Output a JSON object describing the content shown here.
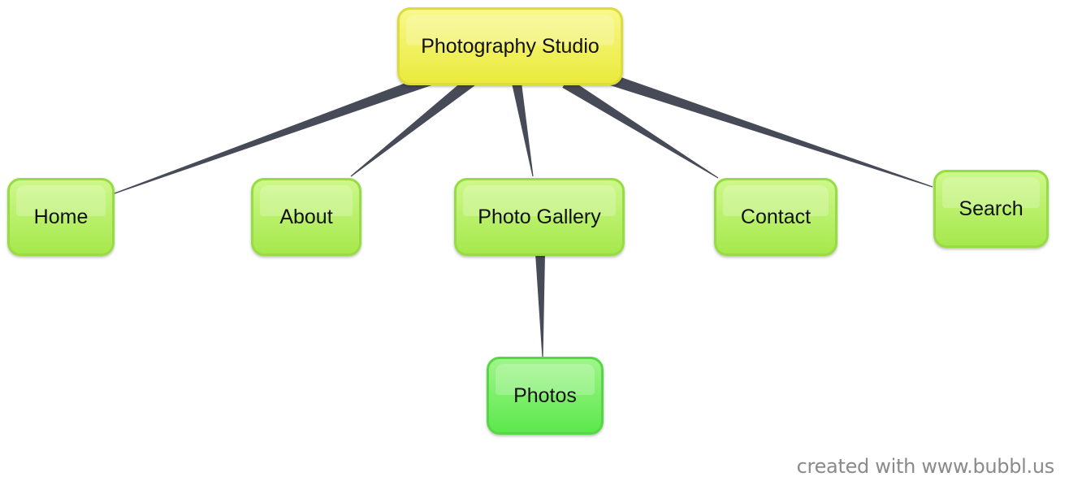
{
  "diagram": {
    "root": {
      "label": "Photography Studio",
      "color": "#eaea3c"
    },
    "children": [
      {
        "label": "Home",
        "color": "#a6e84c"
      },
      {
        "label": "About",
        "color": "#a6e84c"
      },
      {
        "label": "Photo Gallery",
        "color": "#a6e84c",
        "children": [
          {
            "label": "Photos",
            "color": "#5ce84c"
          }
        ]
      },
      {
        "label": "Contact",
        "color": "#a6e84c"
      },
      {
        "label": "Search",
        "color": "#a6e84c"
      }
    ],
    "connector_color": "#474a57"
  },
  "footer": {
    "credit": "created with www.bubbl.us"
  }
}
